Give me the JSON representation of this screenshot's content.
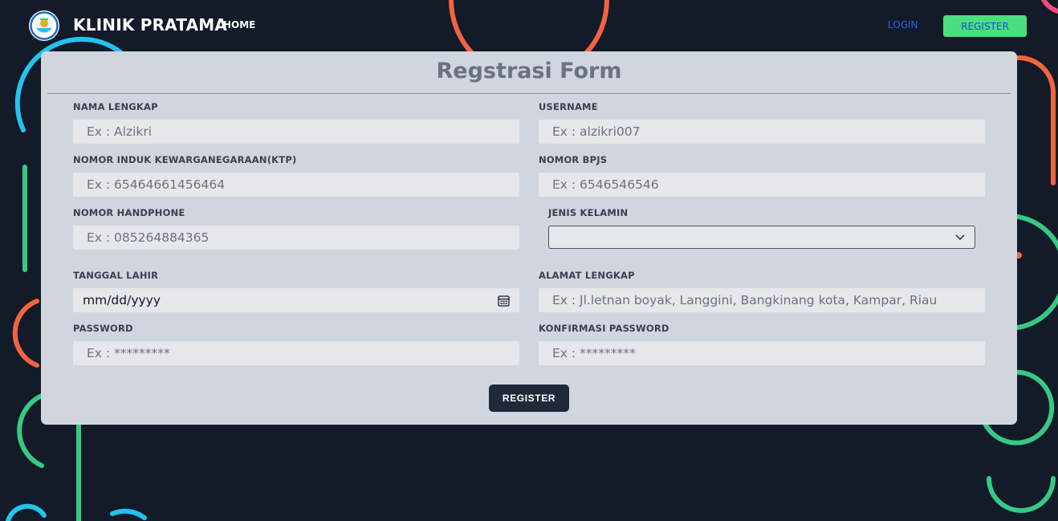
{
  "navbar": {
    "brand": "KLINIK PRATAMA",
    "home_label": "HOME",
    "login_label": "LOGIN",
    "register_label": "REGISTER"
  },
  "form": {
    "title": "Regstrasi Form",
    "fields": {
      "nama_lengkap": {
        "label": "NAMA LENGKAP",
        "placeholder": "Ex : Alzikri",
        "value": ""
      },
      "username": {
        "label": "USERNAME",
        "placeholder": "Ex : alzikri007",
        "value": ""
      },
      "nik": {
        "label": "NOMOR INDUK KEWARGANEGARAAN(KTP)",
        "placeholder": "Ex : 65464661456464",
        "value": ""
      },
      "bpjs": {
        "label": "NOMOR BPJS",
        "placeholder": "Ex : 6546546546",
        "value": ""
      },
      "handphone": {
        "label": "NOMOR HANDPHONE",
        "placeholder": "Ex : 085264884365",
        "value": ""
      },
      "jenis_kelamin": {
        "label": "JENIS KELAMIN",
        "selected": ""
      },
      "tanggal_lahir": {
        "label": "TANGGAL LAHIR",
        "value": "mm/dd/yyyy"
      },
      "alamat": {
        "label": "ALAMAT LENGKAP",
        "placeholder": "Ex : Jl.letnan boyak, Langgini, Bangkinang kota, Kampar, Riau",
        "value": ""
      },
      "password": {
        "label": "PASSWORD",
        "placeholder": "Ex : *********",
        "value": ""
      },
      "konfirmasi_password": {
        "label": "KONFIRMASI PASSWORD",
        "placeholder": "Ex : *********",
        "value": ""
      }
    },
    "submit_label": "REGISTER"
  },
  "icons": {
    "logo": "clinic-logo-icon",
    "calendar": "calendar-icon",
    "chevron": "chevron-down-icon"
  },
  "colors": {
    "background": "#131a28",
    "card": "#d1d5de",
    "input": "#e5e7eb",
    "register_nav": "#4ade80",
    "login_link": "#2563eb",
    "submit": "#1f2937",
    "arc_orange": "#f26440",
    "arc_green": "#35c985",
    "arc_cyan": "#22c4ee",
    "arc_pink": "#ec4d7a"
  }
}
